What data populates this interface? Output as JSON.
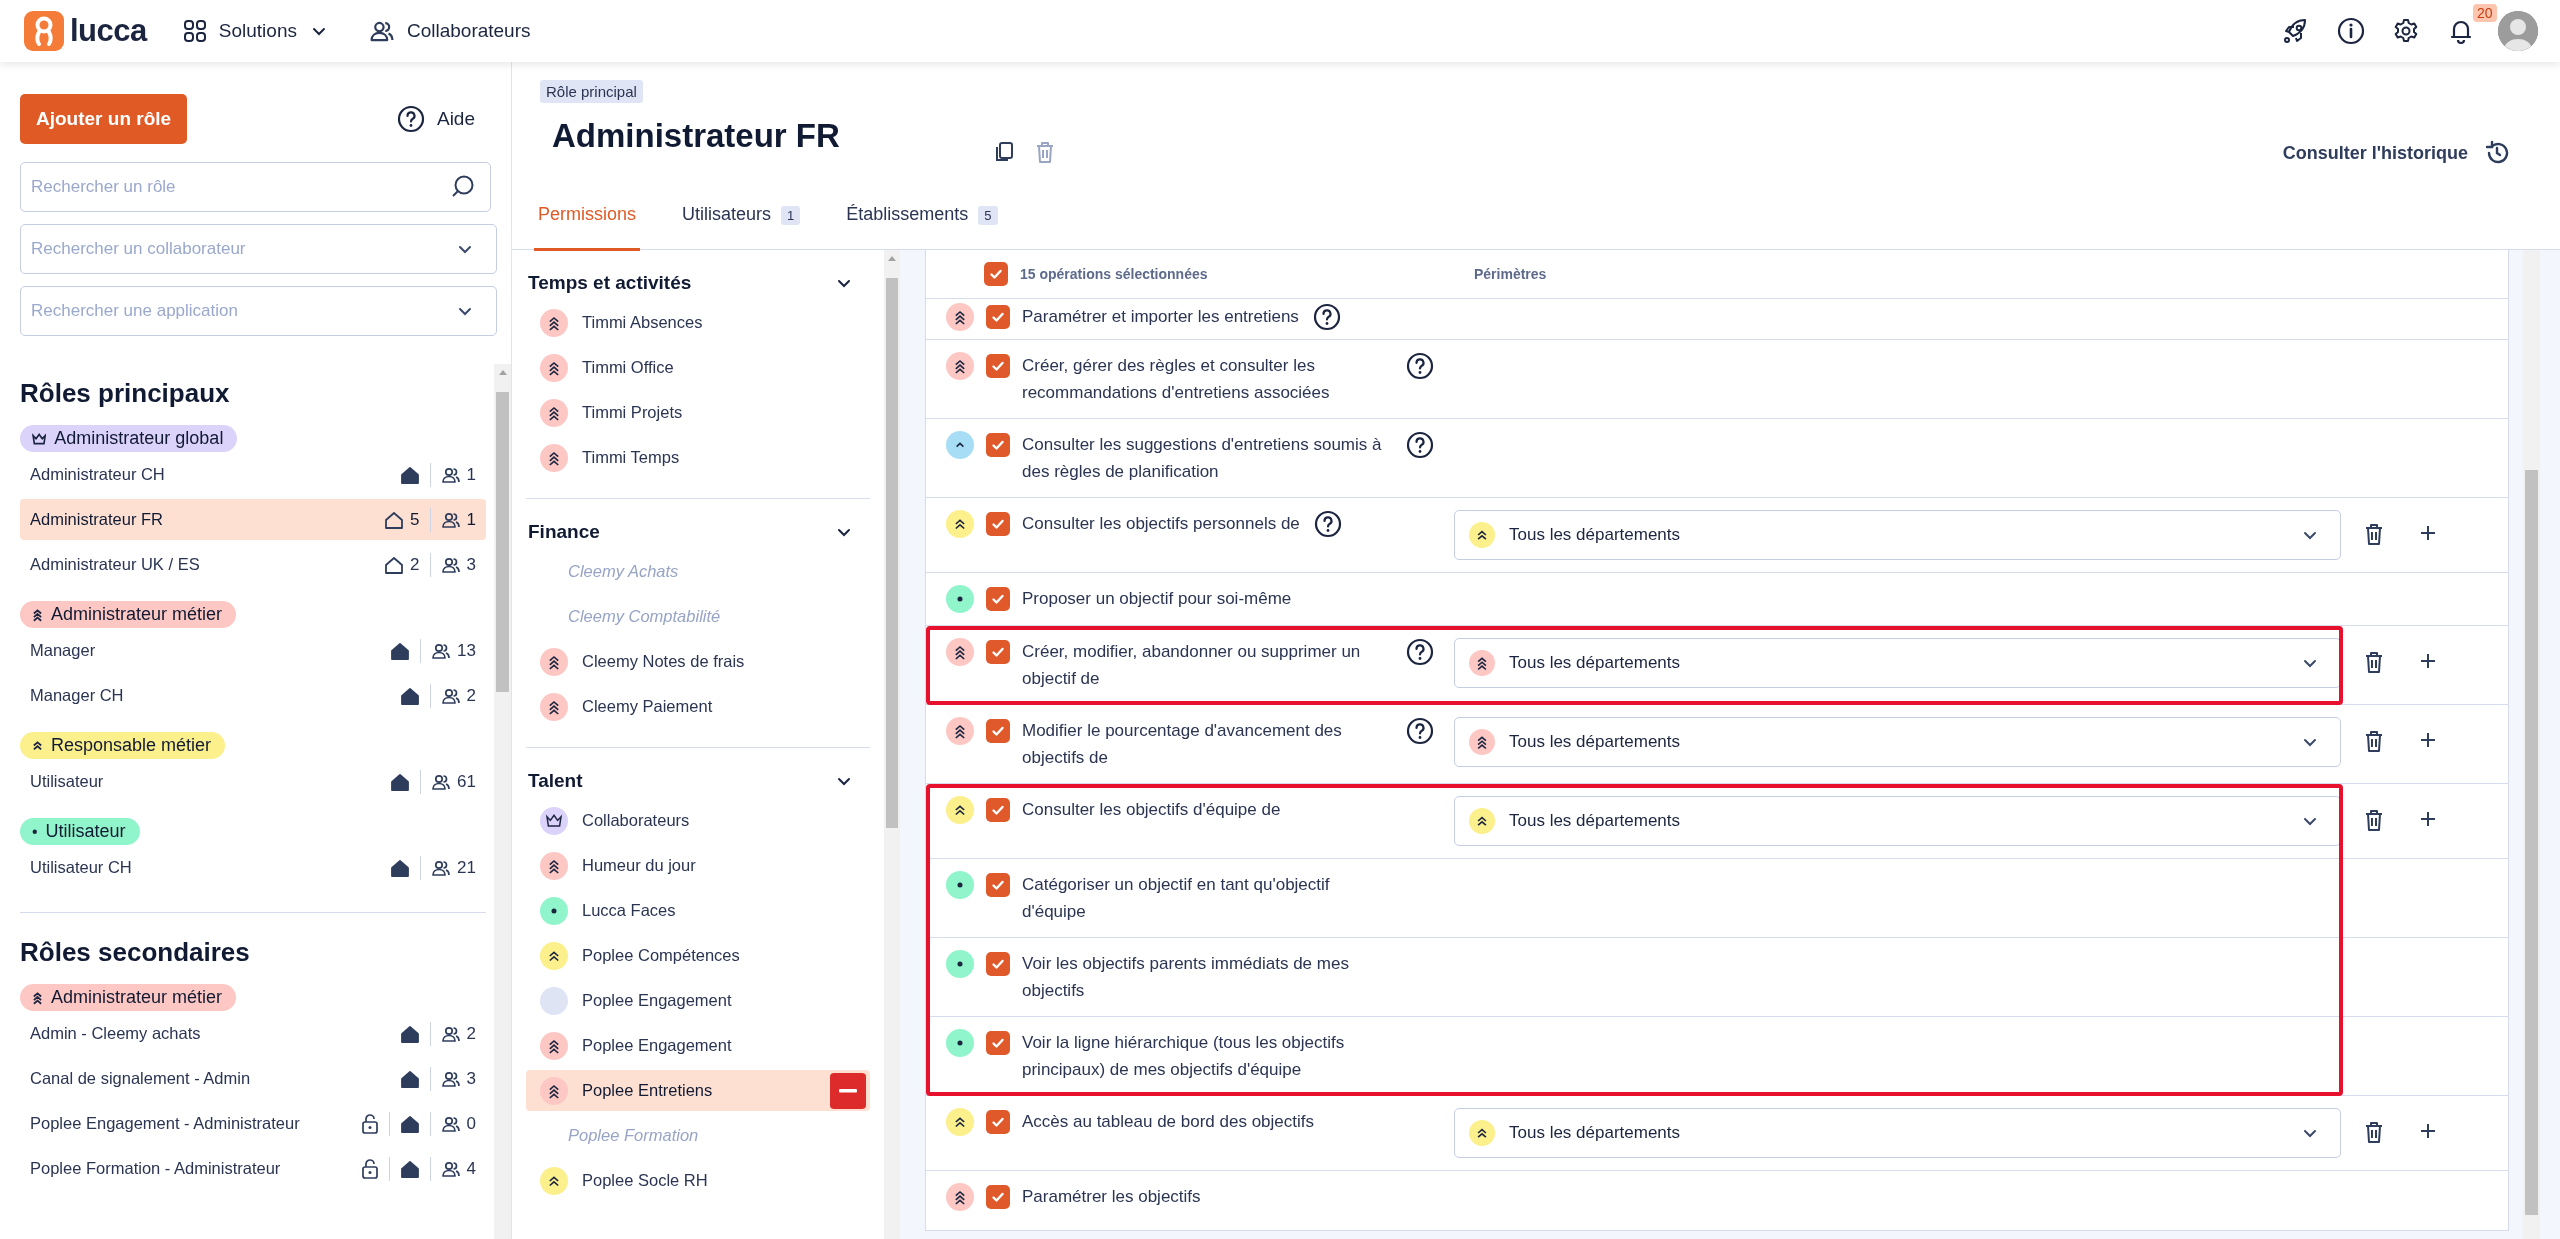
{
  "topbar": {
    "logo": "lucca",
    "nav": [
      {
        "label": "Solutions",
        "kind": "menu"
      },
      {
        "label": "Collaborateurs",
        "kind": "people"
      }
    ],
    "notifications": "20"
  },
  "sidebar": {
    "add_button": "Ajouter un rôle",
    "help": "Aide",
    "search": [
      {
        "placeholder": "Rechercher un rôle",
        "kind": "search"
      },
      {
        "placeholder": "Rechercher un collaborateur",
        "kind": "select"
      },
      {
        "placeholder": "Rechercher une application",
        "kind": "select"
      }
    ],
    "sections": [
      {
        "title": "Rôles principaux",
        "groups": [
          {
            "label": "Administrateur global",
            "kind": "crown",
            "items": [
              {
                "name": "Administrateur CH",
                "locked": false,
                "users": "1",
                "selected": false
              },
              {
                "name": "Administrateur FR",
                "locked": false,
                "sites": "5",
                "users": "1",
                "selected": true
              },
              {
                "name": "Administrateur UK / ES",
                "locked": false,
                "sites": "2",
                "users": "3",
                "selected": false
              }
            ]
          },
          {
            "label": "Administrateur métier",
            "kind": "double",
            "items": [
              {
                "name": "Manager",
                "locked": false,
                "users": "13",
                "selected": false
              },
              {
                "name": "Manager CH",
                "locked": false,
                "users": "2",
                "selected": false
              }
            ]
          },
          {
            "label": "Responsable métier",
            "kind": "single",
            "items": [
              {
                "name": "Utilisateur",
                "locked": false,
                "users": "61",
                "selected": false
              }
            ]
          },
          {
            "label": "Utilisateur",
            "kind": "dot",
            "items": [
              {
                "name": "Utilisateur CH",
                "locked": false,
                "users": "21",
                "selected": false
              }
            ]
          }
        ]
      },
      {
        "title": "Rôles secondaires",
        "groups": [
          {
            "label": "Administrateur métier",
            "kind": "double",
            "items": [
              {
                "name": "Admin - Cleemy achats",
                "locked": false,
                "users": "2",
                "selected": false
              },
              {
                "name": "Canal de signalement - Admin",
                "locked": false,
                "users": "3",
                "selected": false
              },
              {
                "name": "Poplee Engagement - Administrateur",
                "locked": true,
                "users": "0",
                "selected": false
              },
              {
                "name": "Poplee Formation - Administrateur",
                "locked": true,
                "users": "4",
                "selected": false
              }
            ]
          }
        ]
      }
    ]
  },
  "role": {
    "tag": "Rôle principal",
    "title": "Administrateur FR",
    "history": "Consulter l'historique"
  },
  "tabs": [
    {
      "label": "Permissions",
      "selected": true
    },
    {
      "label": "Utilisateurs",
      "count": "1",
      "selected": false
    },
    {
      "label": "Établissements",
      "count": "5",
      "selected": false
    }
  ],
  "applications": [
    {
      "title": "Temps et activités",
      "expanded": true,
      "items": [
        {
          "name": "Timmi Absences",
          "kind": "double",
          "disabled": false,
          "selected": false
        },
        {
          "name": "Timmi Office",
          "kind": "double",
          "disabled": false,
          "selected": false
        },
        {
          "name": "Timmi Projets",
          "kind": "double",
          "disabled": false,
          "selected": false
        },
        {
          "name": "Timmi Temps",
          "kind": "double",
          "disabled": false,
          "selected": false
        }
      ]
    },
    {
      "title": "Finance",
      "expanded": true,
      "items": [
        {
          "name": "Cleemy Achats",
          "disabled": true,
          "selected": false
        },
        {
          "name": "Cleemy Comptabilité",
          "disabled": true,
          "selected": false
        },
        {
          "name": "Cleemy Notes de frais",
          "kind": "double",
          "disabled": false,
          "selected": false
        },
        {
          "name": "Cleemy Paiement",
          "kind": "double",
          "disabled": false,
          "selected": false
        }
      ]
    },
    {
      "title": "Talent",
      "expanded": true,
      "items": [
        {
          "name": "Collaborateurs",
          "kind": "crown",
          "disabled": false,
          "selected": false
        },
        {
          "name": "Humeur du jour",
          "kind": "double",
          "disabled": false,
          "selected": false
        },
        {
          "name": "Lucca Faces",
          "kind": "dot",
          "disabled": false,
          "selected": false
        },
        {
          "name": "Poplee Compétences",
          "kind": "single",
          "disabled": false,
          "selected": false
        },
        {
          "name": "Poplee Engagement",
          "kind": "none",
          "disabled": false,
          "selected": false
        },
        {
          "name": "Poplee Engagement",
          "kind": "double",
          "disabled": false,
          "selected": false
        },
        {
          "name": "Poplee Entretiens",
          "kind": "double",
          "disabled": false,
          "selected": true
        },
        {
          "name": "Poplee Formation",
          "disabled": true,
          "selected": false
        },
        {
          "name": "Poplee Socle RH",
          "kind": "single",
          "disabled": false,
          "selected": false
        }
      ]
    }
  ],
  "permissions": {
    "all_checked": true,
    "selected_count": "15 opérations sélectionnées",
    "scope_header": "Périmètres",
    "rows": [
      {
        "kind": "double",
        "checked": true,
        "label": "Paramétrer et importer les entretiens",
        "help": true,
        "highlighted": false
      },
      {
        "kind": "double",
        "checked": true,
        "label": "Créer, gérer des règles et consulter les recommandations d'entretiens associées",
        "help": true,
        "highlighted": false
      },
      {
        "kind": "caret",
        "checked": true,
        "label": "Consulter les suggestions d'entretiens soumis à des règles de planification",
        "help": true,
        "highlighted": false
      },
      {
        "kind": "single",
        "checked": true,
        "label": "Consulter les objectifs personnels de",
        "help": true,
        "scope": {
          "kind": "single",
          "value": "Tous les départements"
        },
        "highlighted": false
      },
      {
        "kind": "dot",
        "checked": true,
        "label": "Proposer un objectif pour soi-même",
        "help": false,
        "highlighted": false
      },
      {
        "kind": "double",
        "checked": true,
        "label": "Créer, modifier, abandonner ou supprimer un objectif de",
        "help": true,
        "scope": {
          "kind": "double",
          "value": "Tous les départements"
        },
        "highlighted": true
      },
      {
        "kind": "double",
        "checked": true,
        "label": "Modifier le pourcentage d'avancement des objectifs de",
        "help": true,
        "scope": {
          "kind": "double",
          "value": "Tous les départements"
        },
        "highlighted": false
      },
      {
        "kind": "single",
        "checked": true,
        "label": "Consulter les objectifs d'équipe de",
        "help": false,
        "scope": {
          "kind": "single",
          "value": "Tous les départements"
        },
        "highlighted": true
      },
      {
        "kind": "dot",
        "checked": true,
        "label": "Catégoriser un objectif en tant qu'objectif d'équipe",
        "help": false,
        "highlighted": true
      },
      {
        "kind": "dot",
        "checked": true,
        "label": "Voir les objectifs parents immédiats de mes objectifs",
        "help": false,
        "highlighted": true
      },
      {
        "kind": "dot",
        "checked": true,
        "label": "Voir la ligne hiérarchique (tous les objectifs principaux) de mes objectifs d'équipe",
        "help": false,
        "highlighted": true
      },
      {
        "kind": "single",
        "checked": true,
        "label": "Accès au tableau de bord des objectifs",
        "help": false,
        "scope": {
          "kind": "single",
          "value": "Tous les départements"
        },
        "highlighted": false
      },
      {
        "kind": "double",
        "checked": true,
        "label": "Paramétrer les objectifs",
        "help": false,
        "highlighted": false
      }
    ]
  }
}
